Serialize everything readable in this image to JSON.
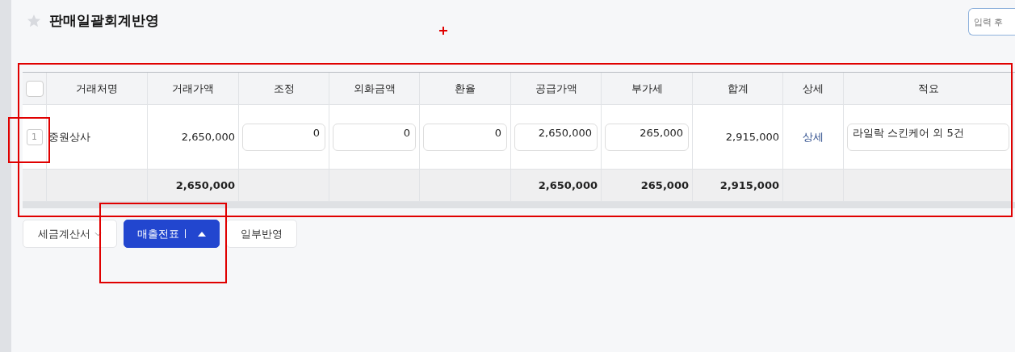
{
  "page": {
    "title": "판매일괄회계반영",
    "favorite": false
  },
  "search": {
    "placeholder": "입력 후"
  },
  "table": {
    "select_all": {
      "checked": false
    },
    "columns": [
      {
        "label": "거래처명"
      },
      {
        "label": "거래가액",
        "total": "2,650,000"
      },
      {
        "label": "조정"
      },
      {
        "label": "외화금액"
      },
      {
        "label": "환율"
      },
      {
        "label": "공급가액",
        "total": "2,650,000"
      },
      {
        "label": "부가세",
        "total": "265,000"
      },
      {
        "label": "합계",
        "total": "2,915,000"
      },
      {
        "label": "상세"
      },
      {
        "label": "적요"
      }
    ],
    "rows": [
      {
        "number": "1",
        "cells": [
          {
            "kind": "text",
            "value": "중원상사"
          },
          {
            "kind": "number",
            "value": "2,650,000"
          },
          {
            "kind": "input",
            "value": "0"
          },
          {
            "kind": "input",
            "value": "0"
          },
          {
            "kind": "input",
            "value": "0"
          },
          {
            "kind": "input",
            "value": "2,650,000"
          },
          {
            "kind": "input",
            "value": "265,000"
          },
          {
            "kind": "number",
            "value": "2,915,000"
          },
          {
            "kind": "link",
            "value": "상세"
          },
          {
            "kind": "textinput",
            "value": "라일락 스킨케어 외 5건"
          }
        ]
      }
    ]
  },
  "buttons": [
    {
      "kind": "dropdown",
      "label": "세금계산서"
    },
    {
      "kind": "split",
      "label": "매출전표",
      "primary": true
    },
    {
      "kind": "plain",
      "label": "일부반영"
    }
  ]
}
